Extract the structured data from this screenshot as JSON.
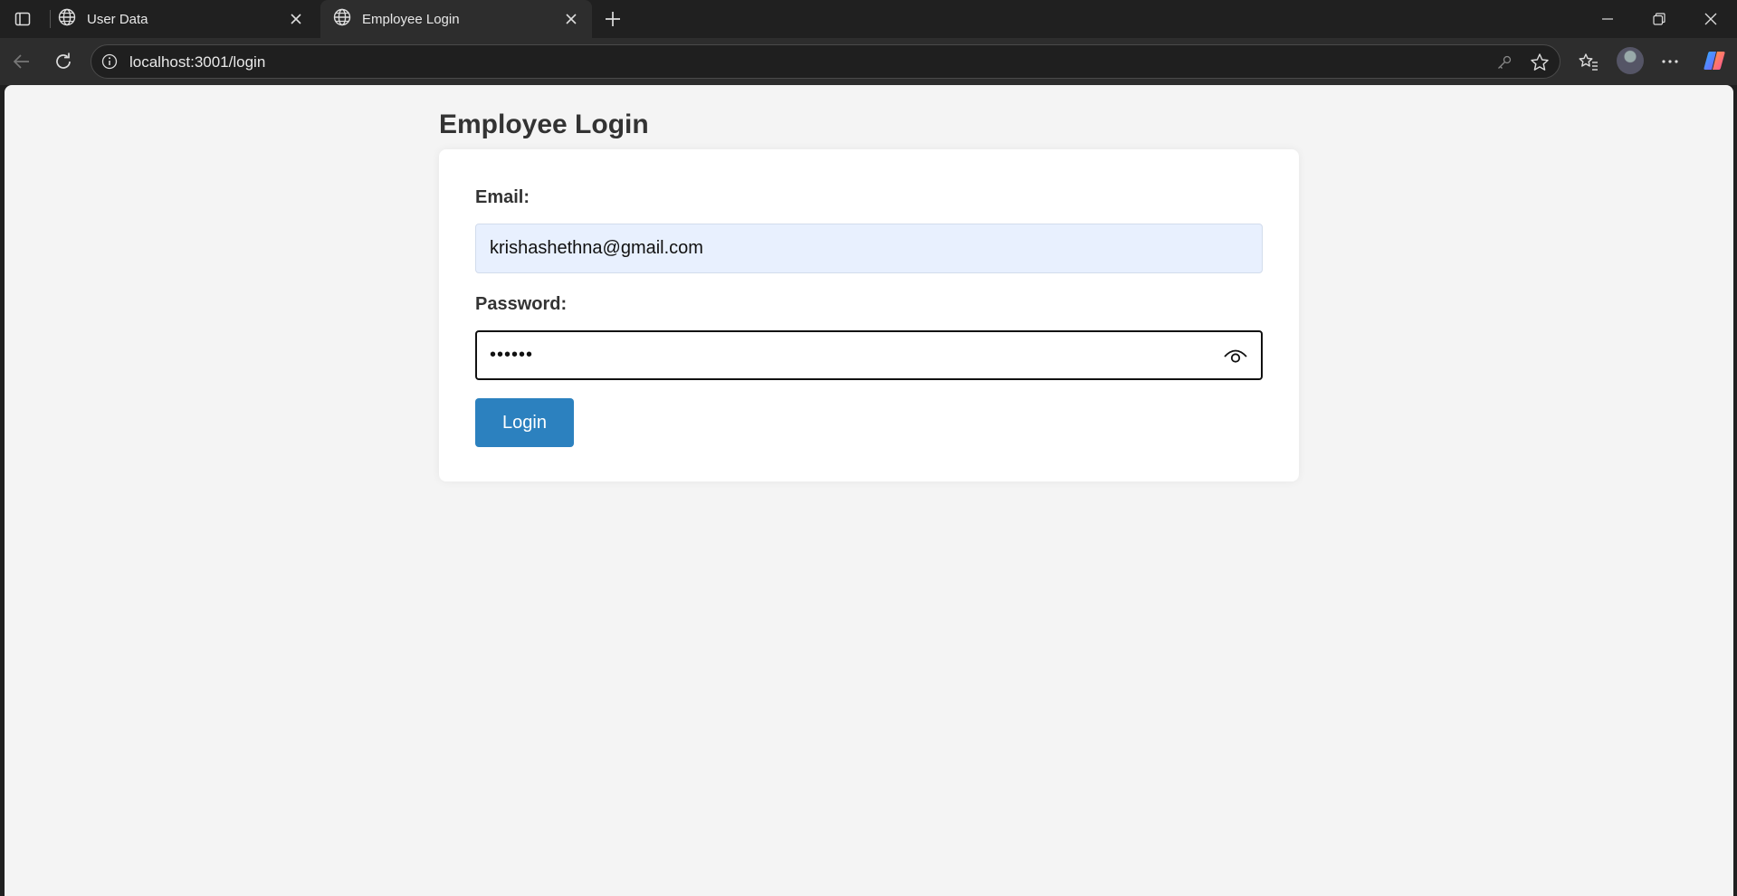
{
  "browser": {
    "tabs": [
      {
        "title": "User Data",
        "icon": "globe-icon",
        "active": false
      },
      {
        "title": "Employee Login",
        "icon": "globe-icon",
        "active": true
      }
    ],
    "address_bar": {
      "url": "localhost:3001/login"
    }
  },
  "page": {
    "title": "Employee Login",
    "form": {
      "email_label": "Email:",
      "email_value": "krishashethna@gmail.com",
      "password_label": "Password:",
      "password_value": "••••••",
      "login_label": "Login"
    }
  },
  "colors": {
    "page_background": "#f4f4f4",
    "card_background": "#ffffff",
    "autofill_background": "#e8f0fe",
    "button_primary": "#2c81bf",
    "chrome_dark": "#202020"
  }
}
